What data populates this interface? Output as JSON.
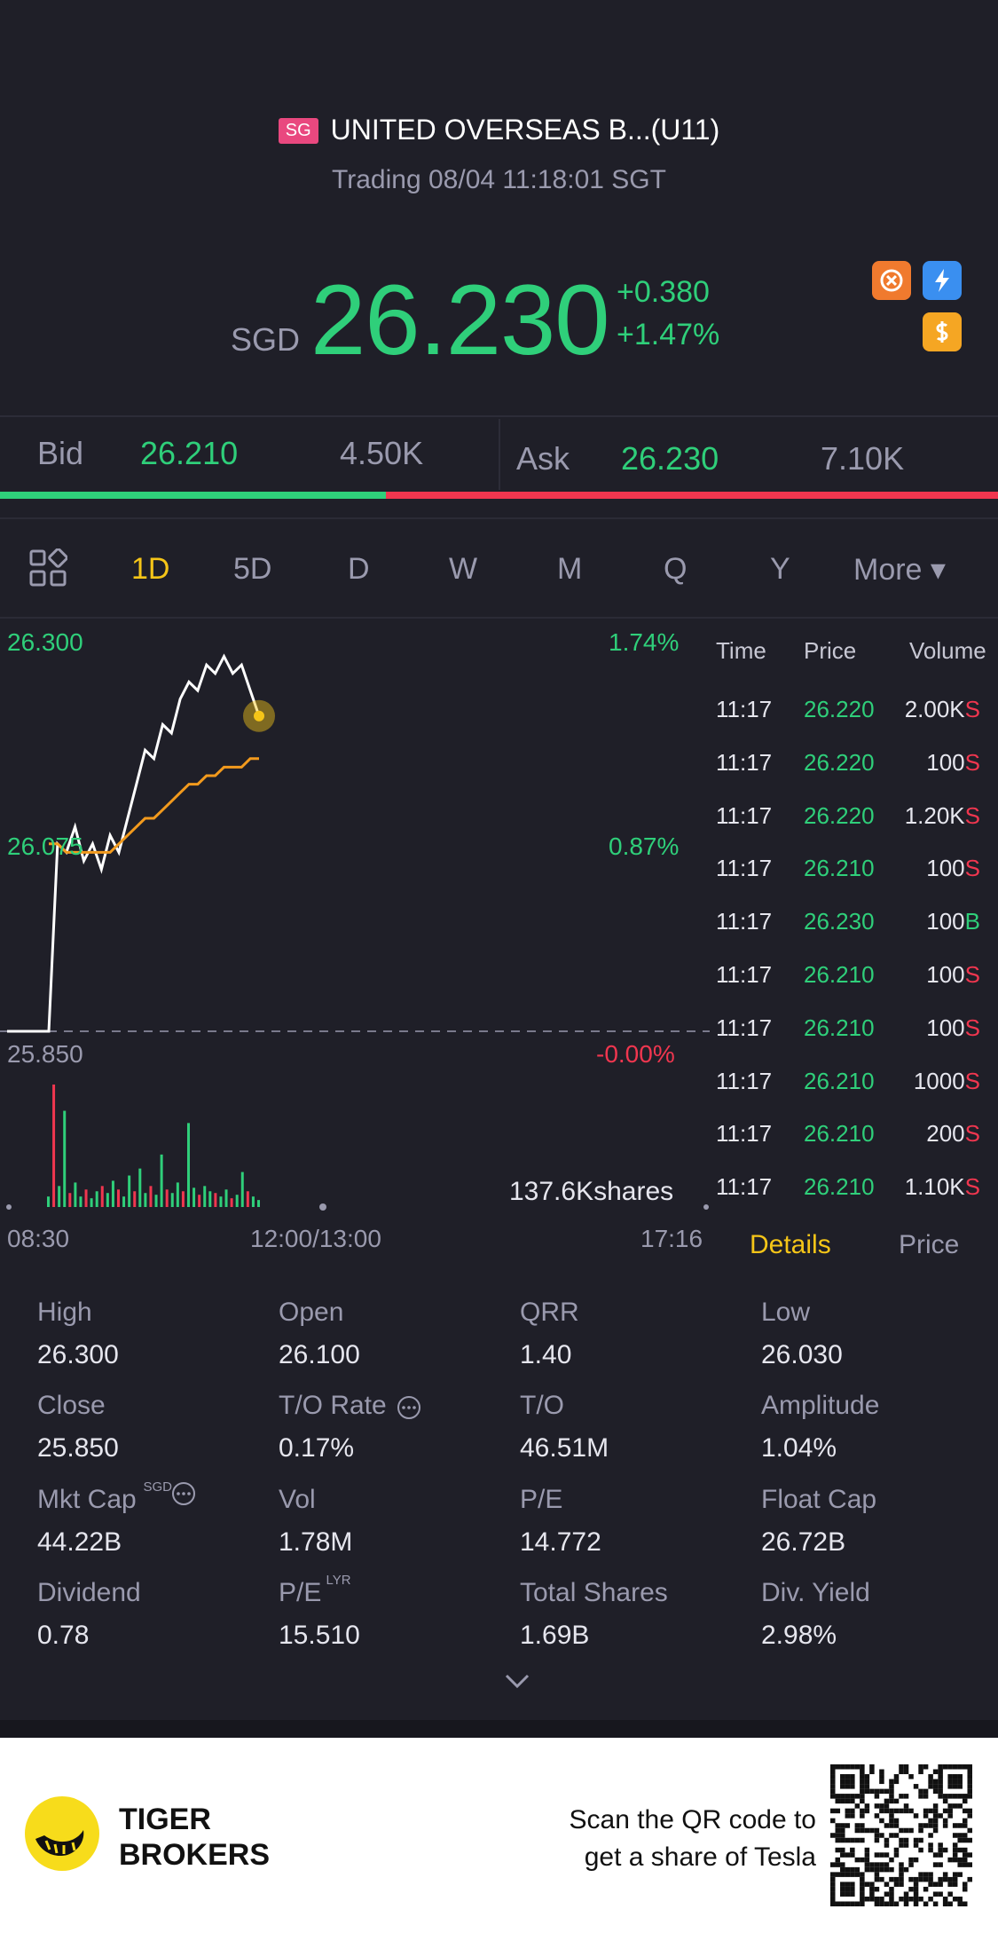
{
  "header": {
    "market_badge": "SG",
    "title": "UNITED OVERSEAS B...(U11)",
    "status": "Trading 08/04 11:18:01 SGT"
  },
  "quote": {
    "currency": "SGD",
    "price": "26.230",
    "change": "+0.380",
    "change_pct": "+1.47%"
  },
  "bidask": {
    "bid_label": "Bid",
    "bid_price": "26.210",
    "bid_size": "4.50K",
    "ask_label": "Ask",
    "ask_price": "26.230",
    "ask_size": "7.10K",
    "bid_share": 0.387
  },
  "periods": {
    "items": [
      "1D",
      "5D",
      "D",
      "W",
      "M",
      "Q",
      "Y"
    ],
    "active": "1D",
    "more_label": "More ▾"
  },
  "chart": {
    "y_high": "26.300",
    "y_mid": "26.075",
    "y_low": "25.850",
    "pct_high": "1.74%",
    "pct_mid": "0.87%",
    "pct_low": "-0.00%",
    "volume_label": "137.6Kshares",
    "x_start": "08:30",
    "x_mid": "12:00/13:00",
    "x_end": "17:16"
  },
  "chart_data": {
    "type": "line",
    "series": [
      {
        "values": [
          25.85,
          26.07,
          26.06,
          26.09,
          26.05,
          26.07,
          26.04,
          26.08,
          26.06,
          26.1,
          26.14,
          26.18,
          26.17,
          26.21,
          26.2,
          26.24,
          26.26,
          26.25,
          26.28,
          26.27,
          26.29,
          26.27,
          26.28,
          26.25,
          26.22
        ]
      },
      {
        "values": [
          26.07,
          26.07,
          26.06,
          26.06,
          26.06,
          26.06,
          26.06,
          26.06,
          26.07,
          26.08,
          26.09,
          26.1,
          26.1,
          26.11,
          26.12,
          26.13,
          26.14,
          26.14,
          26.15,
          26.15,
          26.16,
          26.16,
          26.16,
          26.17,
          26.17
        ]
      }
    ],
    "ylim": [
      25.85,
      26.3
    ],
    "volume": [
      6,
      70,
      12,
      55,
      8,
      14,
      6,
      10,
      5,
      9,
      12,
      8,
      15,
      10,
      6,
      18,
      9,
      22,
      8,
      12,
      7,
      30,
      10,
      8,
      14,
      9,
      48,
      11,
      7,
      12,
      9,
      8,
      6,
      10,
      5,
      7,
      20,
      9,
      6,
      4
    ]
  },
  "trades": {
    "headers": {
      "time": "Time",
      "price": "Price",
      "volume": "Volume"
    },
    "rows": [
      {
        "time": "11:17",
        "price": "26.220",
        "vol": "2.00K",
        "side": "S"
      },
      {
        "time": "11:17",
        "price": "26.220",
        "vol": "100",
        "side": "S"
      },
      {
        "time": "11:17",
        "price": "26.220",
        "vol": "1.20K",
        "side": "S"
      },
      {
        "time": "11:17",
        "price": "26.210",
        "vol": "100",
        "side": "S"
      },
      {
        "time": "11:17",
        "price": "26.230",
        "vol": "100",
        "side": "B"
      },
      {
        "time": "11:17",
        "price": "26.210",
        "vol": "100",
        "side": "S"
      },
      {
        "time": "11:17",
        "price": "26.210",
        "vol": "100",
        "side": "S"
      },
      {
        "time": "11:17",
        "price": "26.210",
        "vol": "1000",
        "side": "S"
      },
      {
        "time": "11:17",
        "price": "26.210",
        "vol": "200",
        "side": "S"
      },
      {
        "time": "11:17",
        "price": "26.210",
        "vol": "1.10K",
        "side": "S"
      }
    ],
    "tab_details": "Details",
    "tab_price": "Price"
  },
  "stats": [
    {
      "label": "High",
      "value": "26.300"
    },
    {
      "label": "Open",
      "value": "26.100"
    },
    {
      "label": "QRR",
      "value": "1.40"
    },
    {
      "label": "Low",
      "value": "26.030"
    },
    {
      "label": "Close",
      "value": "25.850"
    },
    {
      "label": "T/O Rate",
      "value": "0.17%"
    },
    {
      "label": "T/O",
      "value": "46.51M"
    },
    {
      "label": "Amplitude",
      "value": "1.04%"
    },
    {
      "label": "Mkt Cap",
      "value": "44.22B",
      "sup": "SGD"
    },
    {
      "label": "Vol",
      "value": "1.78M"
    },
    {
      "label": "P/E",
      "value": "14.772"
    },
    {
      "label": "Float Cap",
      "value": "26.72B"
    },
    {
      "label": "Dividend",
      "value": "0.78"
    },
    {
      "label": "P/E",
      "value": "15.510",
      "sup": "LYR"
    },
    {
      "label": "Total Shares",
      "value": "1.69B"
    },
    {
      "label": "Div. Yield",
      "value": "2.98%"
    }
  ],
  "footer": {
    "brand_line1": "TIGER",
    "brand_line2": "BROKERS",
    "scan_line1": "Scan the QR code to",
    "scan_line2": "get a share of Tesla"
  },
  "colors": {
    "up": "#2fcf7a",
    "down": "#f0364f",
    "accent": "#f5c518",
    "avg_line": "#f29a1d"
  }
}
